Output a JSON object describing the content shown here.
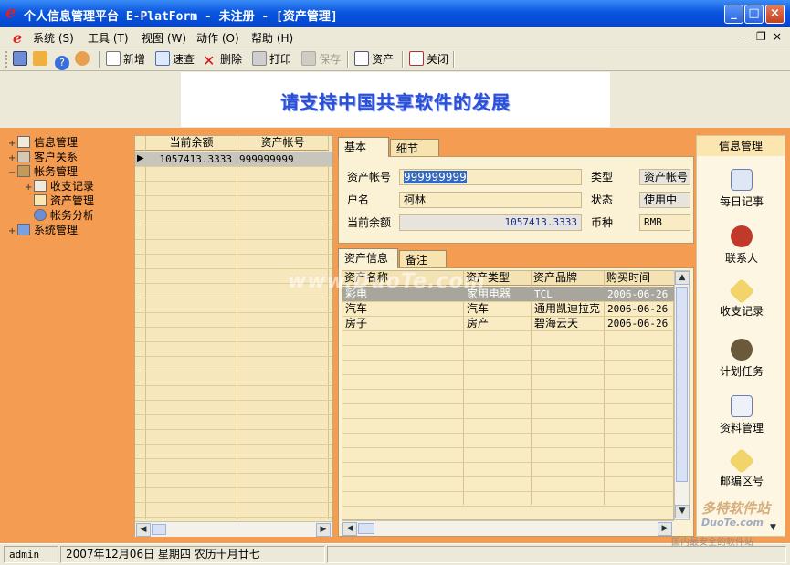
{
  "window": {
    "title": "个人信息管理平台 E-PlatForm - 未注册 - [资产管理]",
    "logo": "e"
  },
  "menu": [
    "系统 (S)",
    "工具 (T)",
    "视图 (W)",
    "动作 (O)",
    "帮助 (H)"
  ],
  "toolbar": {
    "new": "新增",
    "find": "速查",
    "delete": "删除",
    "print": "打印",
    "save": "保存",
    "asset": "资产",
    "close": "关闭"
  },
  "banner": "请支持中国共享软件的发展",
  "tree": [
    {
      "label": "信息管理",
      "exp": "+"
    },
    {
      "label": "客户关系",
      "exp": "+"
    },
    {
      "label": "帐务管理",
      "exp": "−"
    },
    {
      "label": "收支记录",
      "exp": "+"
    },
    {
      "label": "资产管理",
      "exp": ""
    },
    {
      "label": "帐务分析",
      "exp": ""
    },
    {
      "label": "系统管理",
      "exp": "+"
    }
  ],
  "grid": {
    "headers": [
      "当前余额",
      "资产帐号"
    ],
    "rows": [
      [
        "1057413.3333",
        "999999999"
      ]
    ]
  },
  "detail": {
    "tabs": [
      "基本",
      "细节"
    ],
    "account_label": "资产帐号",
    "account_value": "999999999",
    "type_label": "类型",
    "type_value": "资产帐号",
    "name_label": "户名",
    "name_value": "柯林",
    "state_label": "状态",
    "state_value": "使用中",
    "balance_label": "当前余额",
    "balance_value": "1057413.3333",
    "currency_label": "币种",
    "currency_value": "RMB"
  },
  "assets": {
    "tabs": [
      "资产信息",
      "备注"
    ],
    "headers": [
      "资产名称",
      "资产类型",
      "资产品牌",
      "购买时间"
    ],
    "rows": [
      [
        "彩电",
        "家用电器",
        "TCL",
        "2006-06-26"
      ],
      [
        "汽车",
        "汽车",
        "通用凯迪拉克",
        "2006-06-26"
      ],
      [
        "房子",
        "房产",
        "碧海云天",
        "2006-06-26"
      ]
    ]
  },
  "rpanel": {
    "header": "信息管理",
    "items": [
      "每日记事",
      "联系人",
      "收支记录",
      "计划任务",
      "资料管理",
      "邮编区号"
    ]
  },
  "status": {
    "user": "admin",
    "date": "2007年12月06日 星期四 农历十月廿七"
  },
  "watermark": {
    "center": "www.DuoTe.com",
    "corner_top": "多特软件站",
    "corner_mid": "DuoTe.com",
    "corner_bottom": "国内最安全的软件站"
  }
}
